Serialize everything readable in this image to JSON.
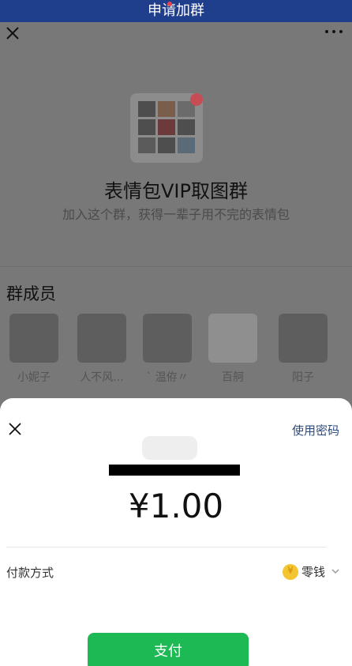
{
  "header": {
    "title": "申请加群"
  },
  "group": {
    "name": "表情包VIP取图群",
    "desc": "加入这个群，获得一辈子用不完的表情包"
  },
  "members": {
    "title": "群成员",
    "items": [
      {
        "name": "小妮子"
      },
      {
        "name": "人不风..."
      },
      {
        "name": "` 温侟〃"
      },
      {
        "name": "百舸"
      },
      {
        "name": "阳子"
      }
    ]
  },
  "payment_sheet": {
    "use_password": "使用密码",
    "amount": "¥1.00",
    "pay_method_label": "付款方式",
    "pay_method_value": "零钱",
    "pay_button": "支付"
  },
  "colors": {
    "topbar": "#1f3f8c",
    "accent": "#1db954",
    "link": "#2b4c7d"
  }
}
